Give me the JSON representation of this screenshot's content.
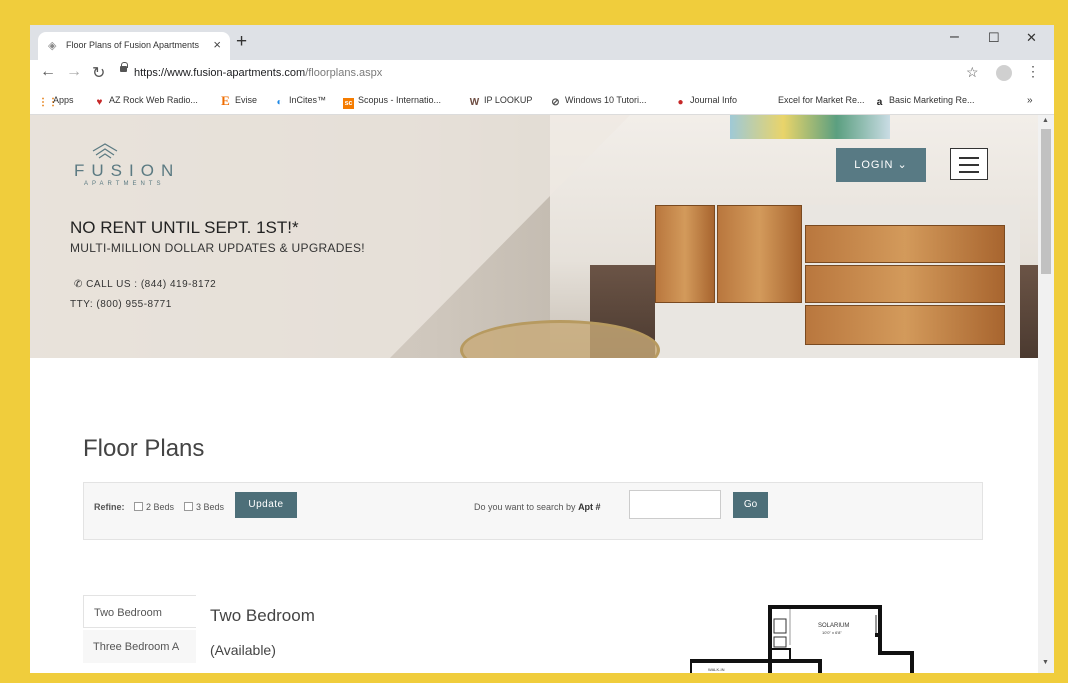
{
  "browser": {
    "tab_title": "Floor Plans of Fusion Apartments",
    "url_host": "https://www.fusion-apartments.com",
    "url_path": "/floorplans.aspx",
    "window_controls": [
      "–",
      "☐",
      "✕"
    ]
  },
  "bookmarks": [
    {
      "label": "Apps",
      "icon": "apps-grid-icon",
      "color": "#e37400"
    },
    {
      "label": "AZ Rock Web Radio...",
      "icon": "radio-icon",
      "color": "#c62828"
    },
    {
      "label": "Evise",
      "icon": "evise-icon",
      "color": "#ef6c00"
    },
    {
      "label": "InCites™",
      "icon": "incites-icon",
      "color": "#1e88e5"
    },
    {
      "label": "Scopus - Internatio...",
      "icon": "scopus-icon",
      "color": "#f57c00"
    },
    {
      "label": "IP LOOKUP",
      "icon": "ip-lookup-icon",
      "color": "#6d4c41"
    },
    {
      "label": "Windows 10 Tutori...",
      "icon": "windows-icon",
      "color": "#555555"
    },
    {
      "label": "Journal Info",
      "icon": "journal-icon",
      "color": "#c62828"
    },
    {
      "label": "Excel for Market Re...",
      "icon": "",
      "color": ""
    },
    {
      "label": "Basic Marketing Re...",
      "icon": "amazon-icon",
      "color": "#222222"
    }
  ],
  "hero": {
    "logo_text": "FUSION",
    "logo_sub": "APARTMENTS",
    "headline": "NO RENT UNTIL SEPT. 1ST!*",
    "subheadline": "MULTI-MILLION DOLLAR UPDATES & UPGRADES!",
    "call_us": "CALL US : (844) 419-8172",
    "tty": "TTY: (800) 955-8771",
    "login_label": "LOGIN ⌄"
  },
  "page": {
    "title": "Floor Plans",
    "refine": {
      "label": "Refine:",
      "options": [
        "2 Beds",
        "3 Beds"
      ],
      "update_label": "Update",
      "apt_search_prefix": "Do you want to search by ",
      "apt_search_bold": "Apt #",
      "go_label": "Go"
    },
    "plan_tabs": [
      "Two Bedroom",
      "Three Bedroom A"
    ],
    "plan_heading": "Two Bedroom",
    "plan_status": "(Available)",
    "floorplan_labels": {
      "solarium": "SOLARIUM",
      "solarium_dims": "10'0\" x 6'8\"",
      "room": "WALK-IN"
    }
  },
  "colors": {
    "accent": "#4d6f79",
    "frame": "#f0cd3c"
  }
}
